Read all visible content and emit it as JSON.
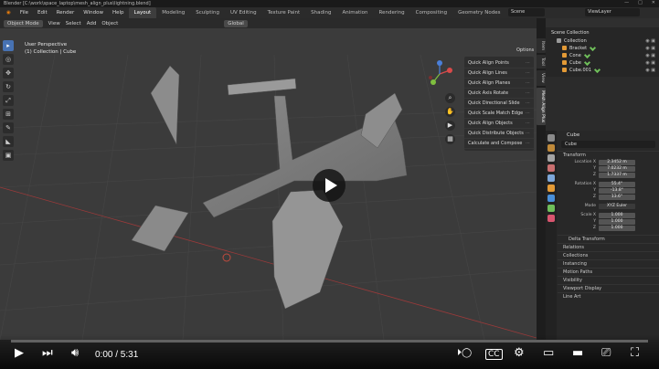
{
  "window": {
    "title": "Blender [C:\\work\\space_laptop\\mesh_align_plus\\lightning.blend]",
    "controls": [
      "—",
      "□",
      "✕"
    ]
  },
  "menubar": {
    "menus": [
      "File",
      "Edit",
      "Render",
      "Window",
      "Help"
    ],
    "workspaces": [
      "Layout",
      "Modeling",
      "Sculpting",
      "UV Editing",
      "Texture Paint",
      "Shading",
      "Animation",
      "Rendering",
      "Compositing",
      "Geometry Nodes",
      "Scripting"
    ],
    "active_workspace": "Layout",
    "scene": "Scene",
    "view_layer": "ViewLayer"
  },
  "viewport": {
    "mode": "Object Mode",
    "menus": [
      "View",
      "Select",
      "Add",
      "Object"
    ],
    "transform": "Global",
    "info_line1": "User Perspective",
    "info_line2": "(1) Collection | Cube",
    "options_label": "Options"
  },
  "addon_panel": {
    "items": [
      "Quick Align Points",
      "Quick Align Lines",
      "Quick Align Planes",
      "Quick Axis Rotate",
      "Quick Directional Slide",
      "Quick Scale Match Edge",
      "Quick Align Objects",
      "Quick Distribute Objects",
      "Calculate and Compose"
    ]
  },
  "side_tabs": [
    "Item",
    "Tool",
    "View",
    "Mesh Align Plus"
  ],
  "outliner": {
    "title": "Scene Collection",
    "rows": [
      {
        "label": "Collection",
        "indent": 1
      },
      {
        "label": "Bracket",
        "indent": 2
      },
      {
        "label": "Cone",
        "indent": 2
      },
      {
        "label": "Cube",
        "indent": 2
      },
      {
        "label": "Cube.001",
        "indent": 2
      }
    ]
  },
  "properties": {
    "object_label": "Cube",
    "object_name": "Cube",
    "transform_label": "Transform",
    "location": {
      "label": "Location X",
      "x": "2.3452 m",
      "y": "7.0232 m",
      "z": "1.7337 m"
    },
    "rotation": {
      "label": "Rotation X",
      "x": "55.4°",
      "y": "-13.8°",
      "z": "13.6°"
    },
    "mode": {
      "label": "Mode",
      "value": "XYZ Euler"
    },
    "scale": {
      "label": "Scale X",
      "x": "1.000",
      "y": "1.000",
      "z": "1.000"
    },
    "sections": [
      "Delta Transform",
      "Relations",
      "Collections",
      "Instancing",
      "Motion Paths",
      "Visibility",
      "Viewport Display",
      "Line Art"
    ]
  },
  "youtube": {
    "time": "0:00 / 5:31",
    "progress": 0
  },
  "colors": {
    "accent": "#4772b3",
    "object_orange": "#e39a36",
    "mesh_green": "#6fbf5a"
  }
}
